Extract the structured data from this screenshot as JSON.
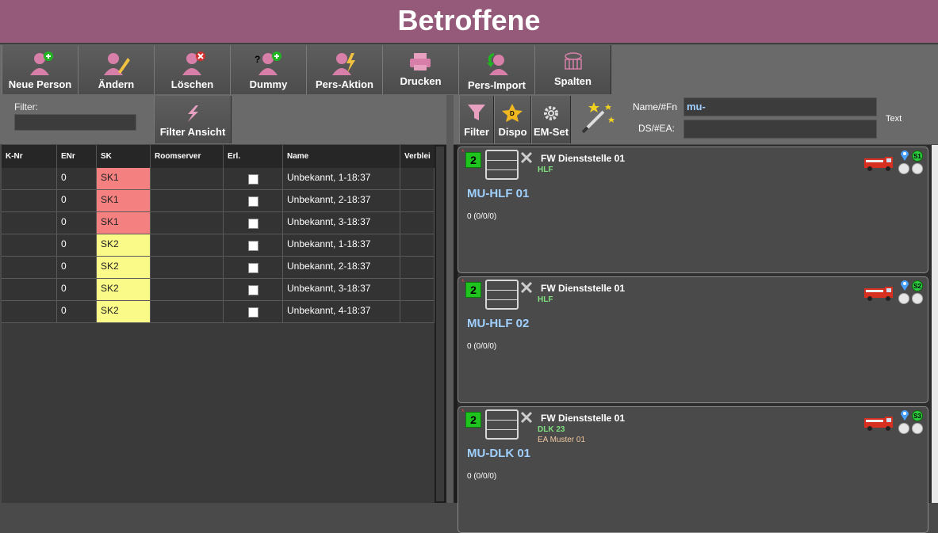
{
  "window": {
    "title": "Betroffene"
  },
  "toolbar": {
    "buttons": [
      {
        "label": "Neue Person",
        "icon": "add-person-icon"
      },
      {
        "label": "Ändern",
        "icon": "edit-person-icon"
      },
      {
        "label": "Löschen",
        "icon": "delete-person-icon"
      },
      {
        "label": "Dummy",
        "icon": "dummy-person-icon"
      },
      {
        "label": "Pers-Aktion",
        "icon": "person-action-icon"
      },
      {
        "label": "Drucken",
        "icon": "print-icon"
      },
      {
        "label": "Pers-Import",
        "icon": "person-import-icon"
      },
      {
        "label": "Spalten",
        "icon": "columns-icon"
      }
    ]
  },
  "filter": {
    "label": "Filter:",
    "value": "",
    "view_button": "Filter Ansicht"
  },
  "table": {
    "columns": [
      "K-Nr",
      "ENr",
      "SK",
      "Roomserver",
      "Erl.",
      "Name",
      "Verblei"
    ],
    "rows": [
      {
        "knr": "",
        "enr": "0",
        "sk": "SK1",
        "roomserver": "",
        "erl": false,
        "name": "Unbekannt, 1-18:37"
      },
      {
        "knr": "",
        "enr": "0",
        "sk": "SK1",
        "roomserver": "",
        "erl": false,
        "name": "Unbekannt, 2-18:37"
      },
      {
        "knr": "",
        "enr": "0",
        "sk": "SK1",
        "roomserver": "",
        "erl": false,
        "name": "Unbekannt, 3-18:37"
      },
      {
        "knr": "",
        "enr": "0",
        "sk": "SK2",
        "roomserver": "",
        "erl": false,
        "name": "Unbekannt, 1-18:37"
      },
      {
        "knr": "",
        "enr": "0",
        "sk": "SK2",
        "roomserver": "",
        "erl": false,
        "name": "Unbekannt, 2-18:37"
      },
      {
        "knr": "",
        "enr": "0",
        "sk": "SK2",
        "roomserver": "",
        "erl": false,
        "name": "Unbekannt, 3-18:37"
      },
      {
        "knr": "",
        "enr": "0",
        "sk": "SK2",
        "roomserver": "",
        "erl": false,
        "name": "Unbekannt, 4-18:37"
      }
    ],
    "sk_colors": {
      "SK1": "#f48080",
      "SK2": "#fafa88"
    }
  },
  "right_toolbar": {
    "filter_label": "Filter",
    "dispo_label": "Dispo",
    "emset_label": "EM-Set",
    "name_label": "Name/#Fn",
    "name_value": "mu-",
    "ds_label": "DS/#EA:",
    "ds_value": "",
    "text_label": "Text"
  },
  "units": [
    {
      "count": "2",
      "station": "FW Dienststelle 01",
      "type": "HLF",
      "ea": "",
      "name": "MU-HLF 01",
      "status": "0  (0/0/0)",
      "badge": "S1"
    },
    {
      "count": "2",
      "station": "FW Dienststelle 01",
      "type": "HLF",
      "ea": "",
      "name": "MU-HLF 02",
      "status": "0  (0/0/0)",
      "badge": "S2"
    },
    {
      "count": "2",
      "station": "FW Dienststelle 01",
      "type": "DLK 23",
      "ea": "EA Muster 01",
      "name": "MU-DLK 01",
      "status": "0  (0/0/0)",
      "badge": "S3"
    }
  ],
  "colors": {
    "titlebar": "#955a79",
    "unit_name": "#9fd0ff",
    "type": "#7fe07f",
    "count_badge": "#1fc41f"
  }
}
